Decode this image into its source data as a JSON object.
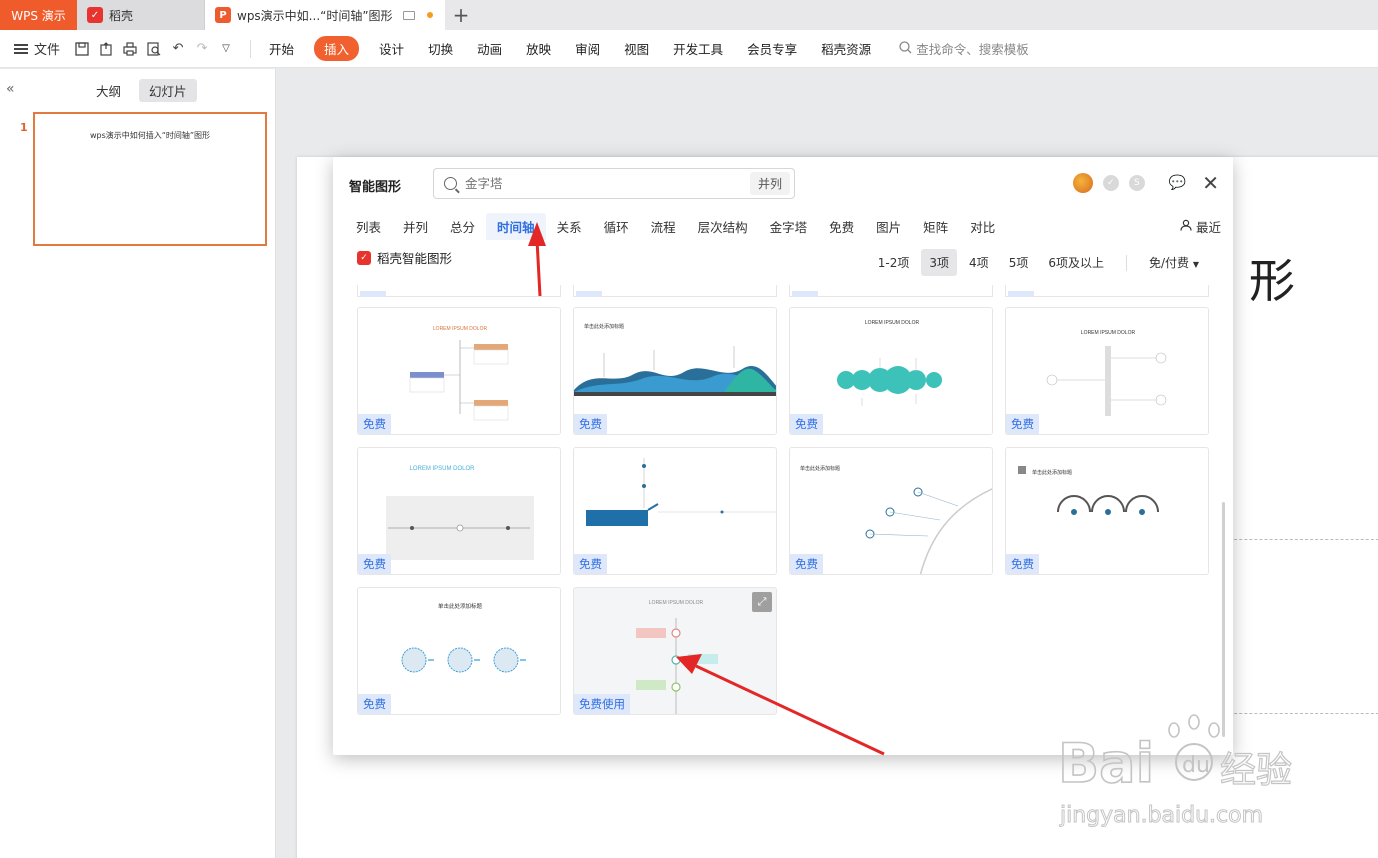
{
  "tabs": {
    "app": "WPS 演示",
    "tab1": "稻壳",
    "tab2": "wps演示中如...“时间轴”图形"
  },
  "menubar": {
    "file": "文件",
    "items": [
      "开始",
      "插入",
      "设计",
      "切换",
      "动画",
      "放映",
      "审阅",
      "视图",
      "开发工具",
      "会员专享",
      "稻壳资源"
    ],
    "active": "插入",
    "search": "查找命令、搜索模板"
  },
  "leftpanel": {
    "outline": "大纲",
    "slides": "幻灯片",
    "slide_number": "1",
    "slide_title": "wps演示中如何插入“时间轴”图形"
  },
  "canvas": {
    "partial_char": "形"
  },
  "dialog": {
    "title": "智能图形",
    "search_placeholder": "金字塔",
    "search_tag": "并列",
    "categories": [
      "列表",
      "并列",
      "总分",
      "时间轴",
      "关系",
      "循环",
      "流程",
      "层次结构",
      "金字塔",
      "免费",
      "图片",
      "矩阵",
      "对比"
    ],
    "active_category": "时间轴",
    "recent": "最近",
    "brand": "稻壳智能图形",
    "filters": [
      "1-2项",
      "3项",
      "4项",
      "5项",
      "6项及以上"
    ],
    "active_filter": "3项",
    "price_filter": "免/付费",
    "cards": [
      {
        "label": "免费",
        "heading": "LOREM IPSUM DOLOR"
      },
      {
        "label": "免费",
        "heading": "单击此处添加标题"
      },
      {
        "label": "免费",
        "heading": "LOREM IPSUM DOLOR"
      },
      {
        "label": "免费",
        "heading": "LOREM IPSUM DOLOR"
      },
      {
        "label": "免费",
        "heading": "LOREM IPSUM DOLOR"
      },
      {
        "label": "免费",
        "heading": ""
      },
      {
        "label": "免费",
        "heading": "单击此处添加标题"
      },
      {
        "label": "免费",
        "heading": "单击此处添加标题"
      },
      {
        "label": "免费",
        "heading": "单击此处添加标题"
      },
      {
        "label": "免费使用",
        "heading": "LOREM IPSUM DOLOR"
      }
    ]
  },
  "colors": {
    "accent": "#f0612f",
    "link_blue": "#2f6fe0",
    "arrow_red": "#e32626"
  }
}
